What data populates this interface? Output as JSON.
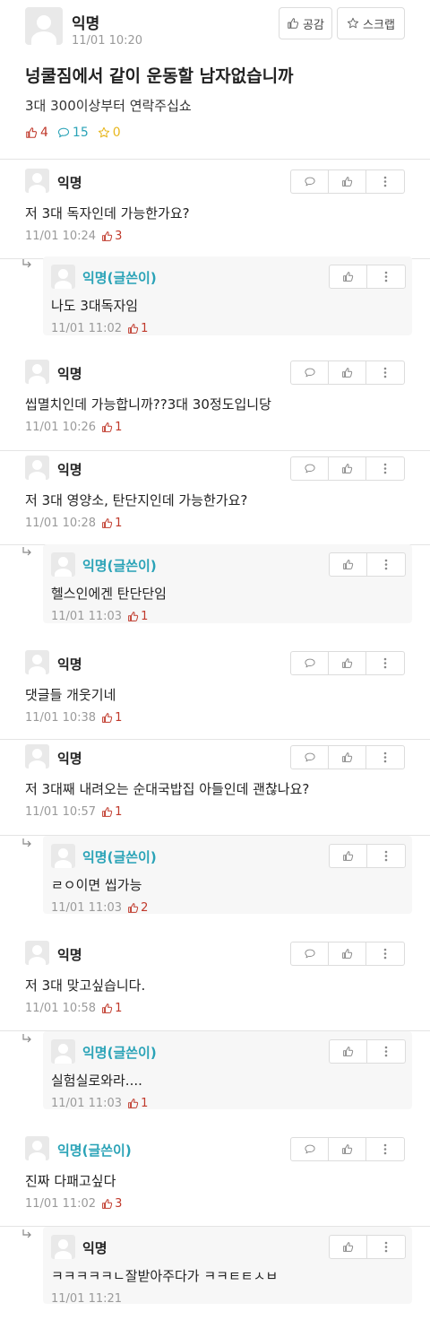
{
  "post": {
    "author": "익명",
    "time": "11/01 10:20",
    "like_button": "공감",
    "scrap_button": "스크랩",
    "title": "넝쿨짐에서 같이 운동할 남자없습니까",
    "body": "3대 300이상부터 연락주십쇼",
    "likes": "4",
    "comments": "15",
    "scraps": "0"
  },
  "colors": {
    "like": "#c0392b",
    "comment": "#2aa3b7",
    "scrap": "#e8b71e",
    "op_author": "#2aa3b7"
  },
  "comments": [
    {
      "author": "익명",
      "text": "저 3대 독자인데 가능한가요?",
      "time": "11/01 10:24",
      "likes": "3"
    },
    {
      "author": "익명(글쓴이)",
      "text": "나도 3대독자임",
      "time": "11/01 11:02",
      "likes": "1"
    },
    {
      "author": "익명",
      "text": "씹멸치인데 가능합니까??3대 30정도입니당",
      "time": "11/01 10:26",
      "likes": "1"
    },
    {
      "author": "익명",
      "text": "저 3대 영양소, 탄단지인데 가능한가요?",
      "time": "11/01 10:28",
      "likes": "1"
    },
    {
      "author": "익명(글쓴이)",
      "text": "헬스인에겐 탄단단임",
      "time": "11/01 11:03",
      "likes": "1"
    },
    {
      "author": "익명",
      "text": "댓글들 개웃기네",
      "time": "11/01 10:38",
      "likes": "1"
    },
    {
      "author": "익명",
      "text": "저 3대째 내려오는 순대국밥집 아들인데 괜찮나요?",
      "time": "11/01 10:57",
      "likes": "1"
    },
    {
      "author": "익명(글쓴이)",
      "text": "ㄹㅇ이면 씹가능",
      "time": "11/01 11:03",
      "likes": "2"
    },
    {
      "author": "익명",
      "text": "저 3대 맞고싶습니다.",
      "time": "11/01 10:58",
      "likes": "1"
    },
    {
      "author": "익명(글쓴이)",
      "text": "실험실로와라....",
      "time": "11/01 11:03",
      "likes": "1"
    },
    {
      "author": "익명(글쓴이)",
      "text": "진짜 다패고싶다",
      "time": "11/01 11:02",
      "likes": "3"
    },
    {
      "author": "익명",
      "text": "ㅋㅋㅋㅋㅋㄴ잘받아주다가 ㅋㅋㅌㅌㅅㅂ",
      "time": "11/01 11:21",
      "likes": ""
    }
  ]
}
